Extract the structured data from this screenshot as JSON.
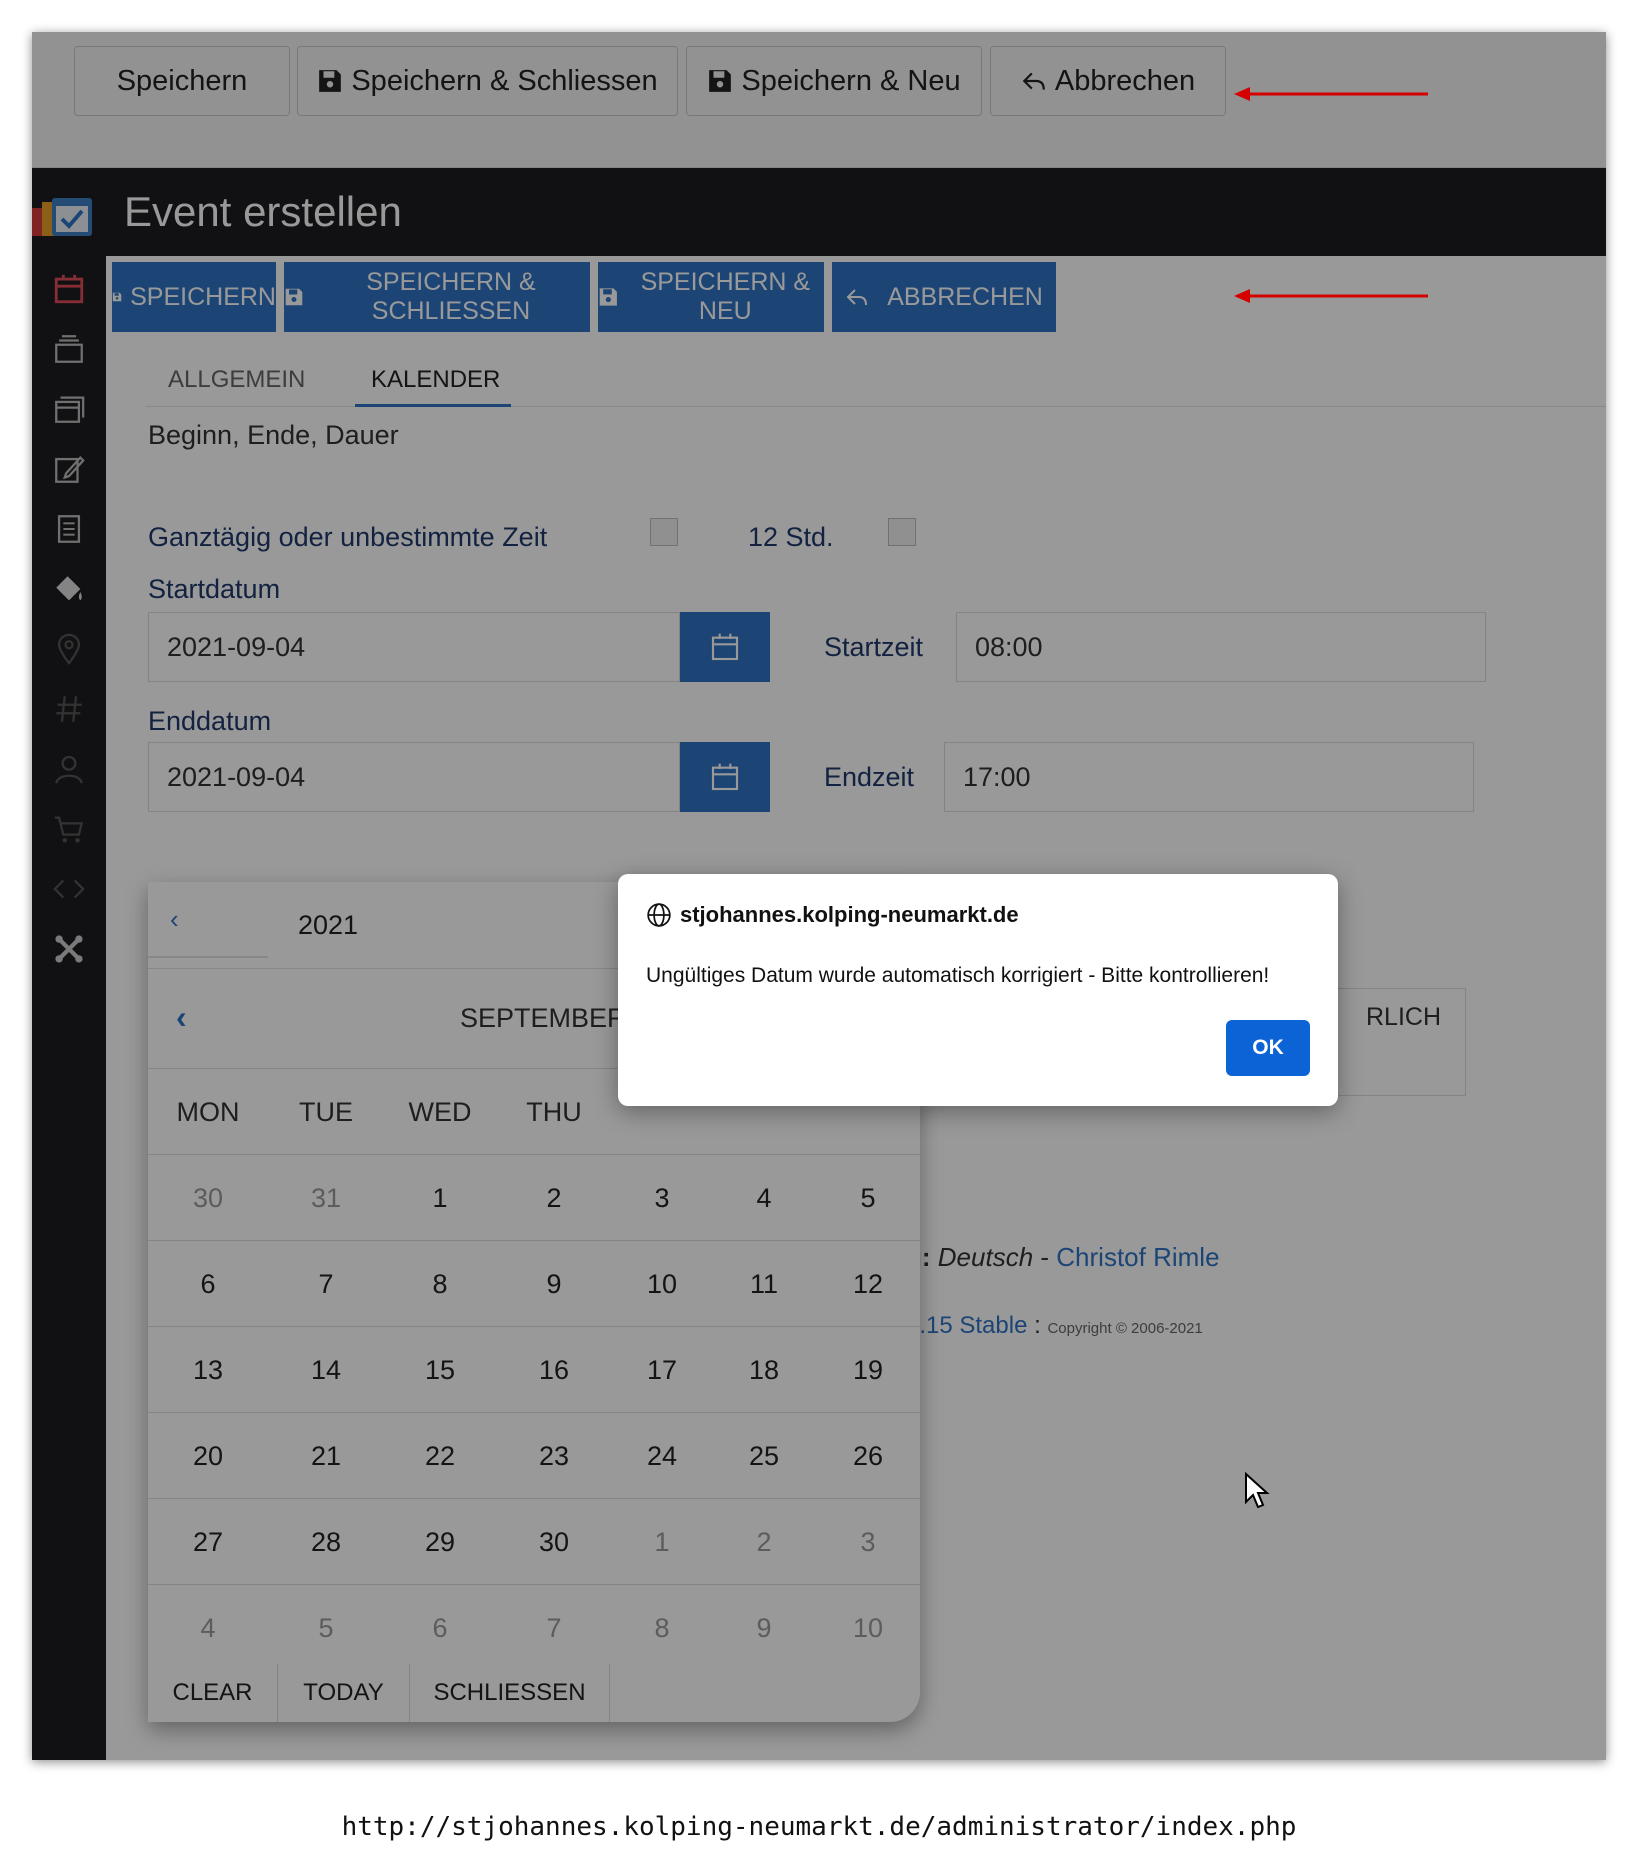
{
  "top_toolbar": {
    "save": "Speichern",
    "save_close": "Speichern & Schliessen",
    "save_new": "Speichern & Neu",
    "cancel": "Abbrechen"
  },
  "header": {
    "title": "Event erstellen"
  },
  "toolbar": {
    "save": "SPEICHERN",
    "save_close": "SPEICHERN & SCHLIESSEN",
    "save_new": "SPEICHERN & NEU",
    "cancel": "ABBRECHEN"
  },
  "tabs": [
    {
      "label": "ALLGEMEIN",
      "active": false
    },
    {
      "label": "KALENDER",
      "active": true
    }
  ],
  "form": {
    "section_title": "Beginn, Ende, Dauer",
    "allday_label": "Ganztägig oder unbestimmte Zeit",
    "hours12_label": "12 Std.",
    "startdate_label": "Startdatum",
    "startdate_value": "2021-09-04",
    "starttime_label": "Startzeit",
    "starttime_value": "08:00",
    "enddate_label": "Enddatum",
    "enddate_value": "2021-09-04",
    "endtime_label": "Endzeit",
    "endtime_value": "17:00",
    "partial_button_text": "RLICH"
  },
  "footer_partial": {
    "lang_prefix": "g:",
    "lang": "Deutsch",
    "sep": " - ",
    "author": "Christof Rimle",
    "version": "5.15 Stable",
    "colon": " : ",
    "copyright": "Copyright © 2006-2021"
  },
  "datepicker": {
    "year_prev": "‹",
    "year": "2021",
    "month_prev": "‹",
    "month": "SEPTEMBER",
    "weekdays": [
      "MON",
      "TUE",
      "WED",
      "THU"
    ],
    "weeks": [
      [
        "30",
        "31",
        "1",
        "2",
        "3",
        "4",
        "5"
      ],
      [
        "6",
        "7",
        "8",
        "9",
        "10",
        "11",
        "12"
      ],
      [
        "13",
        "14",
        "15",
        "16",
        "17",
        "18",
        "19"
      ],
      [
        "20",
        "21",
        "22",
        "23",
        "24",
        "25",
        "26"
      ],
      [
        "27",
        "28",
        "29",
        "30",
        "1",
        "2",
        "3"
      ],
      [
        "4",
        "5",
        "6",
        "7",
        "8",
        "9",
        "10"
      ]
    ],
    "footer": {
      "clear": "CLEAR",
      "today": "TODAY",
      "close": "SCHLIESSEN"
    }
  },
  "dialog": {
    "origin": "stjohannes.kolping-neumarkt.de",
    "message": "Ungültiges Datum wurde automatisch korrigiert - Bitte kontrollieren!",
    "ok": "OK"
  },
  "caption": {
    "url": "http://stjohannes.kolping-neumarkt.de/administrator/index.php"
  },
  "colors": {
    "primary_blue": "#2f74c5",
    "sidebar_dark": "#1d1d20",
    "dialog_ok_blue": "#0b63d6",
    "annotation_red": "#d40000"
  },
  "icons": {
    "sidebar": [
      "calendar-icon",
      "layers-icon",
      "calendars-icon",
      "edit-icon",
      "document-icon",
      "paint-bucket-icon",
      "location-pin-icon",
      "hashtag-icon",
      "user-icon",
      "cart-icon",
      "code-icon",
      "joomla-icon"
    ]
  }
}
